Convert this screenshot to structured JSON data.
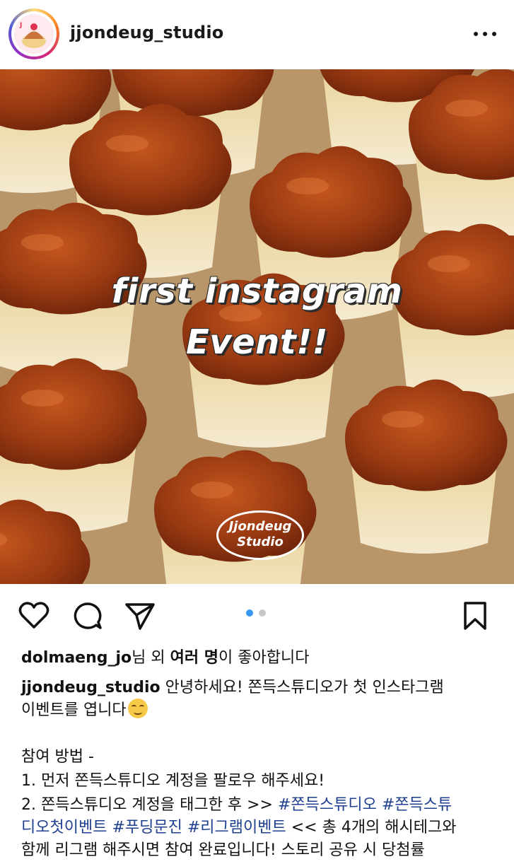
{
  "header": {
    "username": "jjondeug_studio"
  },
  "photo": {
    "overlay_line1": "first instagram",
    "overlay_line2": "Event!!",
    "logo_line1": "Jjondeug",
    "logo_line2": "Studio",
    "carousel": {
      "count": 2,
      "active_index": 0
    }
  },
  "likes": {
    "user": "dolmaeng_jo",
    "mid": "님 외 ",
    "bold": "여러 명",
    "end": "이 좋아합니다"
  },
  "caption": {
    "author": "jjondeug_studio",
    "line1_rest": " 안녕하세요! 쫀득스튜디오가 첫 인스타그램",
    "line2": "이벤트를 엽니다",
    "emoji": "smiling-face-icon",
    "line3": "참여 방법 -",
    "line4": "1. 먼저 쫀득스튜디오 계정을 팔로우 해주세요!",
    "line5_start": "2. 쫀득스튜디오 계정을 태그한 후 >> ",
    "tag1": "#쫀득스튜디오",
    "tag2_part1": "#쫀득스튜",
    "tag2_part2": "디오첫이벤트",
    "tag3": "#푸딩문진",
    "tag4": "#리그램이벤트",
    "line6_end": " << 총 4개의 해시테그와",
    "line7": "함께 리그램 해주시면 참여 완료입니다! 스토리 공유 시 당첨률"
  },
  "colors": {
    "hashtag": "#1f3f8f",
    "carousel_active": "#3897f0",
    "carousel_inactive": "#c7c7c7"
  }
}
